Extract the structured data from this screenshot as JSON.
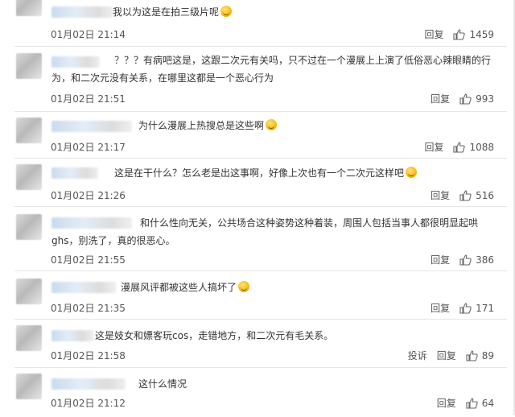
{
  "comments": [
    {
      "text": "我以为这是在拍三级片呢",
      "time": "01月02日 21:14",
      "reply": "回复",
      "likes": "1459"
    },
    {
      "text": "？？？有病吧这是，这跟二次元有关吗，只不过在一个漫展上上演了低俗恶心辣眼睛的行为，和二次元没有关系，在哪里这都是一个恶心行为",
      "time": "01月02日 21:51",
      "reply": "回复",
      "likes": "993"
    },
    {
      "text": "为什么漫展上热搜总是这些啊",
      "time": "01月02日 21:17",
      "reply": "回复",
      "likes": "1088"
    },
    {
      "text": "这是在干什么？怎么老是出这事啊，好像上次也有一个二次元这样吧",
      "time": "01月02日 21:26",
      "reply": "回复",
      "likes": "516"
    },
    {
      "text": "和什么性向无关，公共场合这种姿势这种着装，周围人包括当事人都很明显起哄ghs，别洗了，真的很恶心。",
      "time": "01月02日 21:55",
      "reply": "回复",
      "likes": "386"
    },
    {
      "text": "漫展风评都被这些人搞坏了",
      "time": "01月02日 21:35",
      "reply": "回复",
      "likes": "171"
    },
    {
      "text": "这是妓女和嫖客玩cos，走错地方，和二次元有毛关系。",
      "time": "01月02日 21:58",
      "report": "投诉",
      "reply": "回复",
      "likes": "89"
    },
    {
      "text": "这什么情况",
      "time": "01月02日 21:12",
      "reply": "回复",
      "likes": "64"
    }
  ],
  "colors": {
    "text": "#333333",
    "meta": "#555555",
    "separator": "#e6e6e6"
  }
}
